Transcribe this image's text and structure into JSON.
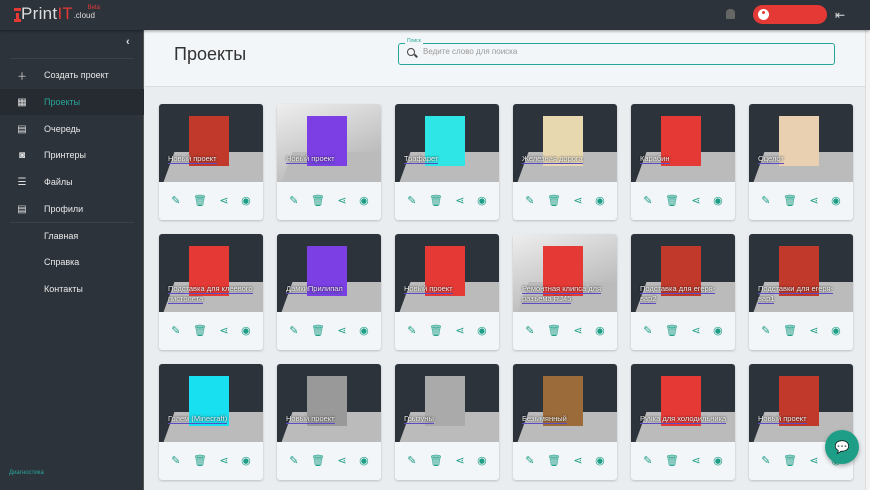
{
  "app": {
    "logo_print": "Print",
    "logo_it": "IT",
    "logo_beta": "Beta",
    "logo_cloud": ".cloud"
  },
  "colors": {
    "accent": "#26a69a",
    "brand": "#e53935",
    "topbar": "#2d333b"
  },
  "sidebar": {
    "collapse": "‹",
    "items": [
      {
        "label": "Создать проект",
        "icon": "＋"
      },
      {
        "label": "Проекты",
        "icon": "▦",
        "active": true
      },
      {
        "label": "Очередь",
        "icon": "▤"
      },
      {
        "label": "Принтеры",
        "icon": "◙"
      },
      {
        "label": "Файлы",
        "icon": "☰"
      },
      {
        "label": "Профили",
        "icon": "▤"
      },
      {
        "label": "Главная"
      },
      {
        "label": "Справка"
      },
      {
        "label": "Контакты"
      }
    ],
    "diagnostics": "Диагностика"
  },
  "header": {
    "title": "Проекты",
    "search_label": "Поиск",
    "search_placeholder": "Ведите слово для поиска"
  },
  "action_icons": {
    "edit": "✎",
    "delete": "🗑",
    "share": "⋖",
    "view": "◉"
  },
  "projects": [
    {
      "name": "Новый проект",
      "bg": "dark",
      "color": "#c0392b"
    },
    {
      "name": "Новый проект",
      "bg": "light",
      "color": "#7b3fe4"
    },
    {
      "name": "Трафарет",
      "bg": "dark",
      "color": "#2ee6e6"
    },
    {
      "name": "Железная дорога",
      "bg": "dark",
      "color": "#e8d8b0"
    },
    {
      "name": "Карабин",
      "bg": "dark",
      "color": "#e53935"
    },
    {
      "name": "Оцелот",
      "bg": "dark",
      "color": "#e8d0b0"
    },
    {
      "name": "Подставка для клеевого пистолета",
      "bg": "dark",
      "color": "#e53935"
    },
    {
      "name": "ДамкиПрилипал",
      "bg": "dark",
      "color": "#7b3fe4"
    },
    {
      "name": "Новый проект",
      "bg": "dark",
      "color": "#e53935"
    },
    {
      "name": "Ремонтная клипса для разъема RJ45",
      "bg": "light",
      "color": "#e53935"
    },
    {
      "name": "Подставка для егеря-вар2",
      "bg": "dark",
      "color": "#c0392b"
    },
    {
      "name": "Подставки для егеря-вар1",
      "bg": "dark",
      "color": "#c0392b"
    },
    {
      "name": "Голем (Minecraft)",
      "bg": "dark",
      "color": "#18e0f0"
    },
    {
      "name": "Новый проект",
      "bg": "dark",
      "color": "#999999"
    },
    {
      "name": "Грызуны",
      "bg": "dark",
      "color": "#aaaaaa"
    },
    {
      "name": "Безымянный",
      "bg": "dark",
      "color": "#9c6b3a"
    },
    {
      "name": "Ручка для холодильника",
      "bg": "dark",
      "color": "#e53935"
    },
    {
      "name": "Новый проект",
      "bg": "dark",
      "color": "#c0392b"
    }
  ],
  "fab": {
    "icon": "💬"
  }
}
